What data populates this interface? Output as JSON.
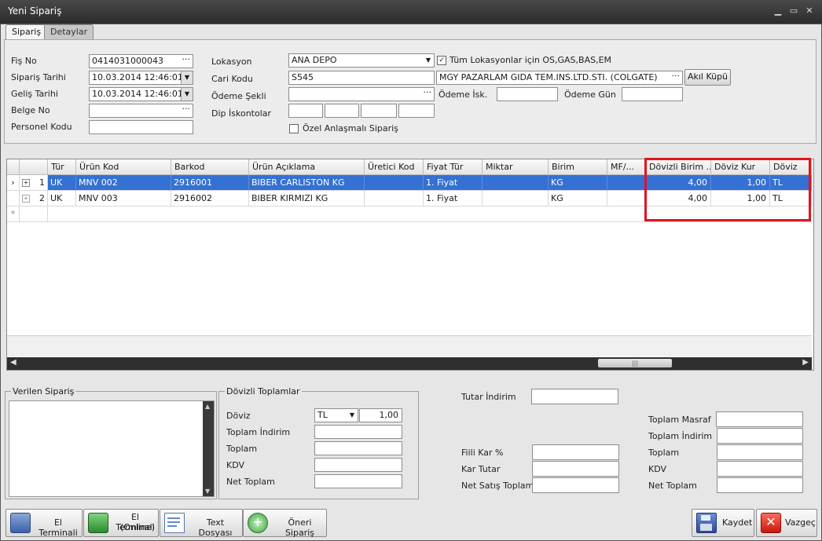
{
  "window": {
    "title": "Yeni Sipariş"
  },
  "tabs": [
    {
      "label": "Sipariş"
    },
    {
      "label": "Detaylar"
    }
  ],
  "form": {
    "fis_no_label": "Fiş No",
    "fis_no": "0414031000043",
    "siparis_tarihi_label": "Sipariş Tarihi",
    "siparis_tarihi": "10.03.2014 12:46:01",
    "gelis_tarihi_label": "Geliş Tarihi",
    "gelis_tarihi": "10.03.2014 12:46:01",
    "belge_no_label": "Belge No",
    "belge_no": "",
    "personel_kodu_label": "Personel Kodu",
    "personel_kodu": "",
    "lokasyon_label": "Lokasyon",
    "lokasyon": "ANA DEPO",
    "tum_lokasyonlar_label": "Tüm Lokasyonlar için OS,GAS,BAS,EM",
    "tum_lokasyonlar_checked": "✓",
    "cari_kodu_label": "Cari Kodu",
    "cari_kodu": "S545",
    "cari_adi": "MGY PAZARLAM GIDA TEM.INS.LTD.STI. (COLGATE)",
    "akil_kupu": "Akıl Küpü",
    "odeme_sekli_label": "Ödeme Şekli",
    "odeme_sekli": "",
    "odeme_isk_label": "Ödeme İsk.",
    "odeme_gun_label": "Ödeme Gün",
    "dip_iskontolar_label": "Dip İskontolar",
    "ozel_anlasmali_label": "Özel Anlaşmalı Sipariş",
    "ellipsis": "···"
  },
  "grid": {
    "columns": [
      "Tür",
      "Ürün Kod",
      "Barkod",
      "Ürün Açıklama",
      "Üretici Kod",
      "Fiyat Tür",
      "Miktar",
      "Birim",
      "MF/...",
      "Dövizli Birim ...",
      "Döviz Kur",
      "Döviz"
    ],
    "rows": [
      {
        "no": "1",
        "tur": "UK",
        "urun_kod": "MNV 002",
        "barkod": "2916001",
        "aciklama": "BIBER CARLISTON KG",
        "uretici": "",
        "fiyat_tur": "1. Fiyat",
        "miktar": "",
        "birim": "KG",
        "mf": "",
        "dovizli": "4,00",
        "kur": "1,00",
        "doviz": "TL"
      },
      {
        "no": "2",
        "tur": "UK",
        "urun_kod": "MNV 003",
        "barkod": "2916002",
        "aciklama": "BIBER KIRMIZI KG",
        "uretici": "",
        "fiyat_tur": "1. Fiyat",
        "miktar": "",
        "birim": "KG",
        "mf": "",
        "dovizli": "4,00",
        "kur": "1,00",
        "doviz": "TL"
      }
    ],
    "new_row_marker": "*",
    "row_indicator": "›",
    "expand": "+",
    "highlight_color": "#e0141e"
  },
  "verilen_siparis": {
    "legend": "Verilen Sipariş"
  },
  "dovizli_toplamlar": {
    "legend": "Dövizli Toplamlar",
    "doviz_label": "Döviz",
    "doviz": "TL",
    "kur": "1,00",
    "toplam_indirim_label": "Toplam İndirim",
    "toplam_label": "Toplam",
    "kdv_label": "KDV",
    "net_toplam_label": "Net Toplam"
  },
  "middle": {
    "tutar_indirim_label": "Tutar İndirim",
    "fiili_kar_label": "Fiili Kar %",
    "kar_tutar_label": "Kar Tutar",
    "net_satis_label": "Net Satış Toplam"
  },
  "right": {
    "toplam_masraf_label": "Toplam Masraf",
    "toplam_indirim_label": "Toplam İndirim",
    "toplam_label": "Toplam",
    "kdv_label": "KDV",
    "net_toplam_label": "Net Toplam"
  },
  "buttons": {
    "el_terminali": "El Terminali",
    "el_terminali_online_1": "El Terminali",
    "el_terminali_online_2": "(Online)",
    "text_dosyasi": "Text Dosyası",
    "oneri_siparis": "Öneri Sipariş",
    "kaydet": "Kaydet",
    "vazgec": "Vazgeç"
  }
}
